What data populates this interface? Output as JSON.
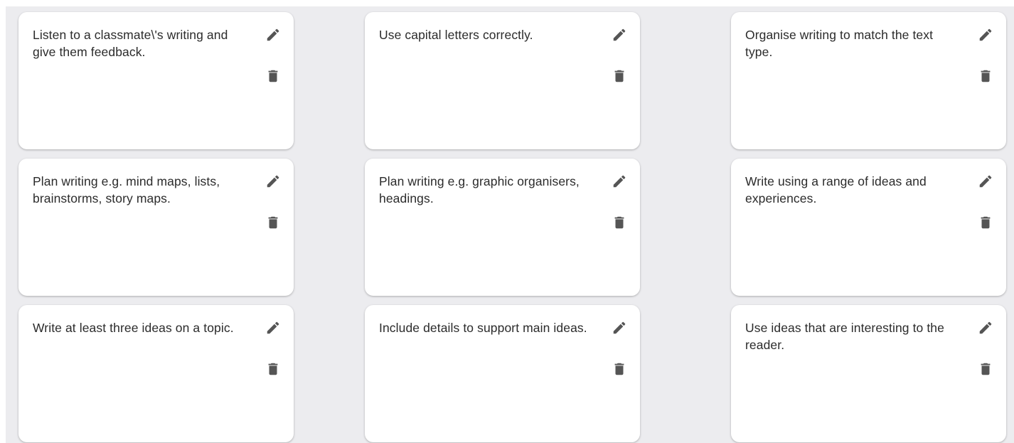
{
  "cards": [
    {
      "text": "Listen to a classmate\\'s writing and give them feedback.",
      "edit_icon": "pencil-icon",
      "delete_icon": "trash-icon"
    },
    {
      "text": "Use capital letters correctly.",
      "edit_icon": "pencil-icon",
      "delete_icon": "trash-icon"
    },
    {
      "text": "Organise writing to match the text type.",
      "edit_icon": "pencil-icon",
      "delete_icon": "trash-icon"
    },
    {
      "text": "Plan writing e.g. mind maps, lists, brainstorms, story maps.",
      "edit_icon": "pencil-icon",
      "delete_icon": "trash-icon"
    },
    {
      "text": "Plan writing e.g. graphic organisers, headings.",
      "edit_icon": "pencil-icon",
      "delete_icon": "trash-icon"
    },
    {
      "text": "Write using a range of ideas and experiences.",
      "edit_icon": "pencil-icon",
      "delete_icon": "trash-icon"
    },
    {
      "text": "Write at least three ideas on a topic.",
      "edit_icon": "pencil-icon",
      "delete_icon": "trash-icon"
    },
    {
      "text": "Include details to support main ideas.",
      "edit_icon": "pencil-icon",
      "delete_icon": "trash-icon"
    },
    {
      "text": "Use ideas that are interesting to the reader.",
      "edit_icon": "pencil-icon",
      "delete_icon": "trash-icon"
    }
  ],
  "colors": {
    "background": "#ececef",
    "card": "#ffffff",
    "text": "#2b2b2b",
    "icon": "#555555"
  }
}
